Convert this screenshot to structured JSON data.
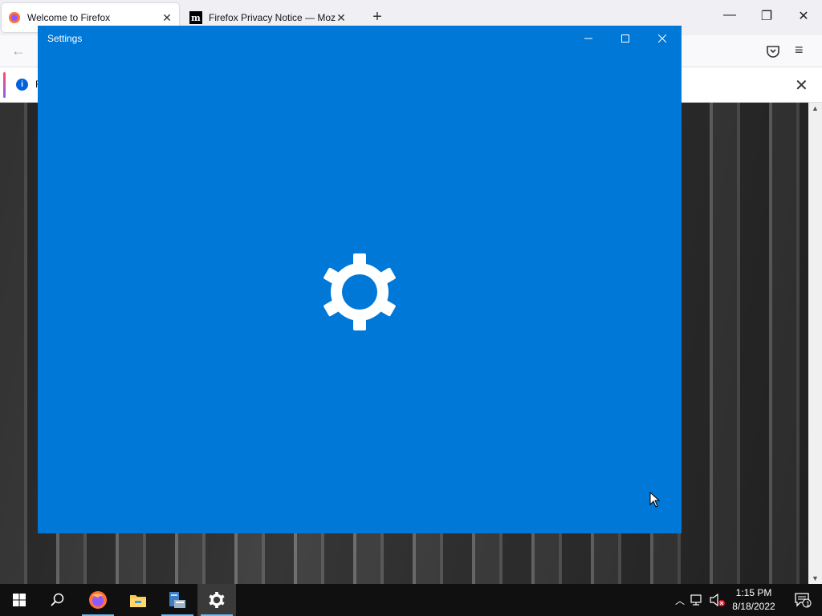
{
  "firefox": {
    "tabs": [
      {
        "title": "Welcome to Firefox",
        "active": true
      },
      {
        "title": "Firefox Privacy Notice — Mozilla",
        "active": false
      }
    ],
    "new_tab_glyph": "+",
    "notice_text_partial": "F"
  },
  "settings_window": {
    "title": "Settings",
    "minimize": "—",
    "maximize": "☐",
    "close": "✕",
    "background_color": "#0078d7",
    "splash_icon": "gear-icon"
  },
  "taskbar": {
    "items": [
      "start-button",
      "search-button",
      "firefox",
      "file-explorer",
      "server-manager",
      "settings"
    ],
    "clock_time": "1:15 PM",
    "clock_date": "8/18/2022",
    "notification_count": "1"
  }
}
